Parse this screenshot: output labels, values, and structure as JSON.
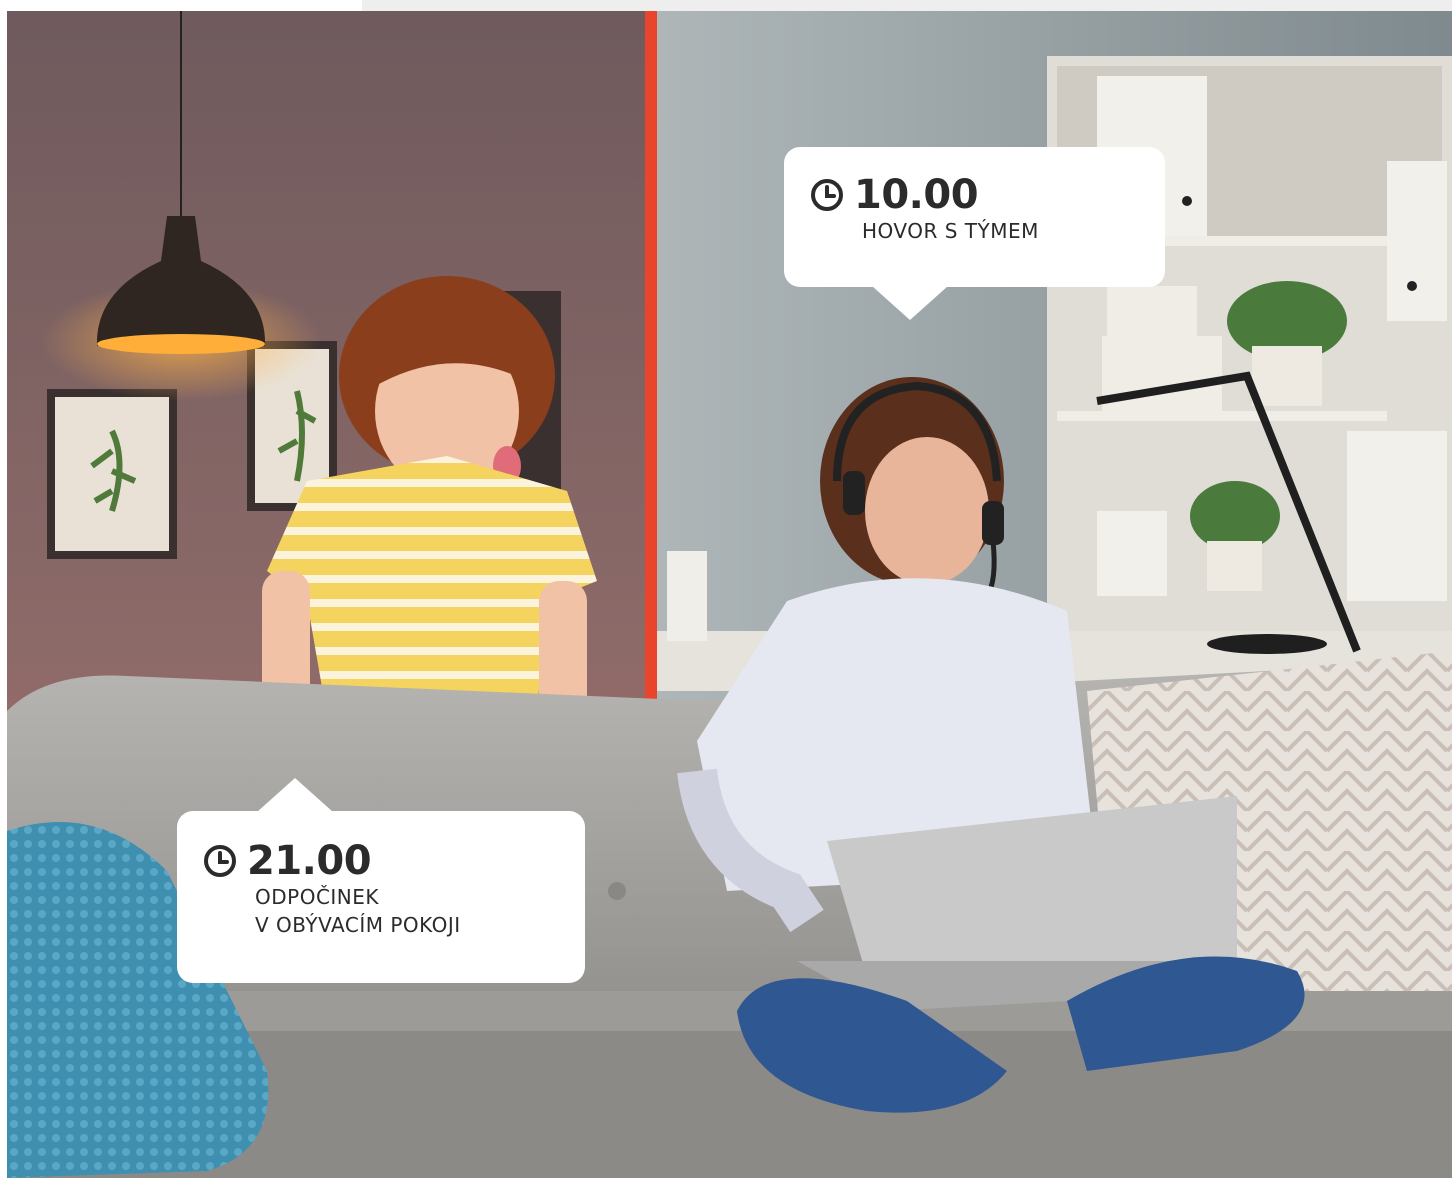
{
  "scene": {
    "left_panel_description": "photo-child-in-living-room",
    "right_panel_description": "photo-woman-on-video-call",
    "divider_color": "#e8452c"
  },
  "bubbles": [
    {
      "time": "10.00",
      "lines": [
        "HOVOR S TÝMEM"
      ],
      "icon": "clock-icon"
    },
    {
      "time": "21.00",
      "lines": [
        "ODPOČINEK",
        "V OBÝVACÍM POKOJI"
      ],
      "icon": "clock-icon"
    }
  ]
}
